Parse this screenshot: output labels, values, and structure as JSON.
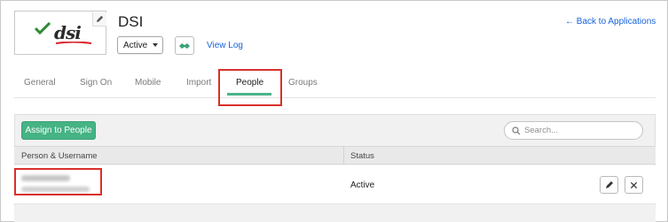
{
  "app": {
    "title": "DSI",
    "logo_text": "dsi",
    "status_value": "Active",
    "view_log": "View Log",
    "back_link": "← Back to Applications"
  },
  "tabs": [
    {
      "label": "General"
    },
    {
      "label": "Sign On"
    },
    {
      "label": "Mobile"
    },
    {
      "label": "Import"
    },
    {
      "label": "People",
      "active": true
    },
    {
      "label": "Groups"
    }
  ],
  "people": {
    "assign_button": "Assign to People",
    "search_placeholder": "Search...",
    "columns": [
      "Person & Username",
      "Status"
    ],
    "rows": [
      {
        "status": "Active"
      }
    ]
  },
  "colors": {
    "accent_green": "#46b385",
    "link_blue": "#1662dd",
    "highlight_red": "#d9302a"
  },
  "icons": [
    "pencil-icon",
    "handshake-icon",
    "search-icon",
    "close-icon",
    "caret-down-icon"
  ]
}
